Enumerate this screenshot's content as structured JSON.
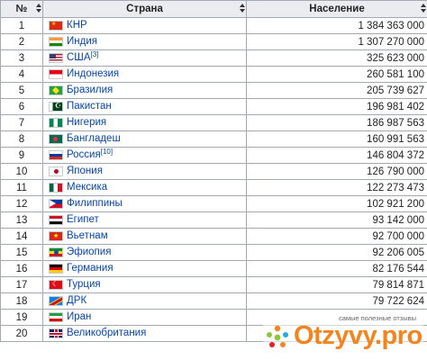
{
  "table": {
    "headers": {
      "num": "№",
      "country": "Страна",
      "population": "Население"
    },
    "rows": [
      {
        "num": "1",
        "flag": "cn-flag-icon",
        "country": "КНР",
        "note": "",
        "population": "1 384 363 000"
      },
      {
        "num": "2",
        "flag": "in-flag-icon",
        "country": "Индия",
        "note": "",
        "population": "1 307 270 000"
      },
      {
        "num": "3",
        "flag": "us-flag-icon",
        "country": "США",
        "note": "[3]",
        "population": "325 623 000"
      },
      {
        "num": "4",
        "flag": "id-flag-icon",
        "country": "Индонезия",
        "note": "",
        "population": "260 581 100"
      },
      {
        "num": "5",
        "flag": "br-flag-icon",
        "country": "Бразилия",
        "note": "",
        "population": "205 739 627"
      },
      {
        "num": "6",
        "flag": "pk-flag-icon",
        "country": "Пакистан",
        "note": "",
        "population": "196 981 402"
      },
      {
        "num": "7",
        "flag": "ng-flag-icon",
        "country": "Нигерия",
        "note": "",
        "population": "186 987 563"
      },
      {
        "num": "8",
        "flag": "bd-flag-icon",
        "country": "Бангладеш",
        "note": "",
        "population": "160 991 563"
      },
      {
        "num": "9",
        "flag": "ru-flag-icon",
        "country": "Россия",
        "note": "[10]",
        "population": "146 804 372"
      },
      {
        "num": "10",
        "flag": "jp-flag-icon",
        "country": "Япония",
        "note": "",
        "population": "126 790 000"
      },
      {
        "num": "11",
        "flag": "mx-flag-icon",
        "country": "Мексика",
        "note": "",
        "population": "122 273 473"
      },
      {
        "num": "12",
        "flag": "ph-flag-icon",
        "country": "Филиппины",
        "note": "",
        "population": "102 921 200"
      },
      {
        "num": "13",
        "flag": "eg-flag-icon",
        "country": "Египет",
        "note": "",
        "population": "93 142 000"
      },
      {
        "num": "14",
        "flag": "vn-flag-icon",
        "country": "Вьетнам",
        "note": "",
        "population": "92 700 000"
      },
      {
        "num": "15",
        "flag": "et-flag-icon",
        "country": "Эфиопия",
        "note": "",
        "population": "92 206 005"
      },
      {
        "num": "16",
        "flag": "de-flag-icon",
        "country": "Германия",
        "note": "",
        "population": "82 176 544"
      },
      {
        "num": "17",
        "flag": "tr-flag-icon",
        "country": "Турция",
        "note": "",
        "population": "79 814 871"
      },
      {
        "num": "18",
        "flag": "cd-flag-icon",
        "country": "ДРК",
        "note": "",
        "population": "79 722 624"
      },
      {
        "num": "19",
        "flag": "ir-flag-icon",
        "country": "Иран",
        "note": "",
        "population": ""
      },
      {
        "num": "20",
        "flag": "gb-flag-icon",
        "country": "Великобритания",
        "note": "",
        "population": ""
      }
    ]
  },
  "watermark": {
    "tagline": "самые полезные отзывы",
    "brand": "Otzyvy.pro",
    "logo_icon": "otzyvy-logo-icon",
    "brand_color": "#f5841f"
  }
}
